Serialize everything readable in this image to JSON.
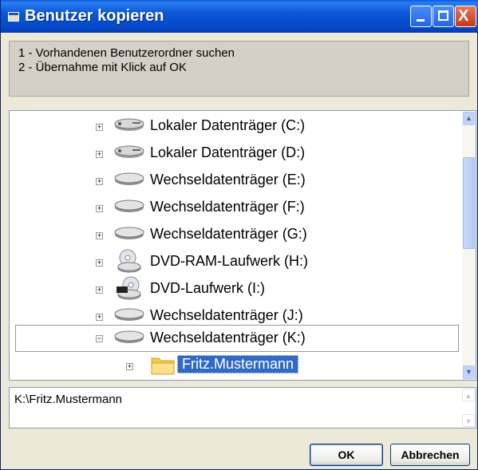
{
  "window": {
    "title": "Benutzer kopieren"
  },
  "instructions": {
    "line1": "1 - Vorhandenen Benutzerordner suchen",
    "line2": "2 - Übernahme mit Klick auf OK"
  },
  "tree": {
    "items": [
      {
        "label": "Lokaler Datenträger (C:)",
        "icon": "hard-drive-icon",
        "expander": "+"
      },
      {
        "label": "Lokaler Datenträger (D:)",
        "icon": "hard-drive-icon",
        "expander": "+"
      },
      {
        "label": "Wechseldatenträger (E:)",
        "icon": "removable-drive-icon",
        "expander": "+"
      },
      {
        "label": "Wechseldatenträger (F:)",
        "icon": "removable-drive-icon",
        "expander": "+"
      },
      {
        "label": "Wechseldatenträger (G:)",
        "icon": "removable-drive-icon",
        "expander": "+"
      },
      {
        "label": "DVD-RAM-Laufwerk (H:)",
        "icon": "dvd-ram-drive-icon",
        "expander": "+"
      },
      {
        "label": "DVD-Laufwerk (I:)",
        "icon": "dvd-drive-icon",
        "expander": "+"
      },
      {
        "label": "Wechseldatenträger (J:)",
        "icon": "removable-drive-icon",
        "expander": "+"
      },
      {
        "label": "Wechseldatenträger (K:)",
        "icon": "removable-drive-icon",
        "expander": "−"
      },
      {
        "label": "Fritz.Mustermann",
        "icon": "folder-icon",
        "expander": "+",
        "selected": true
      }
    ]
  },
  "path_field": {
    "value": "K:\\Fritz.Mustermann"
  },
  "buttons": {
    "ok": "OK",
    "cancel": "Abbrechen"
  },
  "titlebar_buttons": {
    "close": "X"
  }
}
